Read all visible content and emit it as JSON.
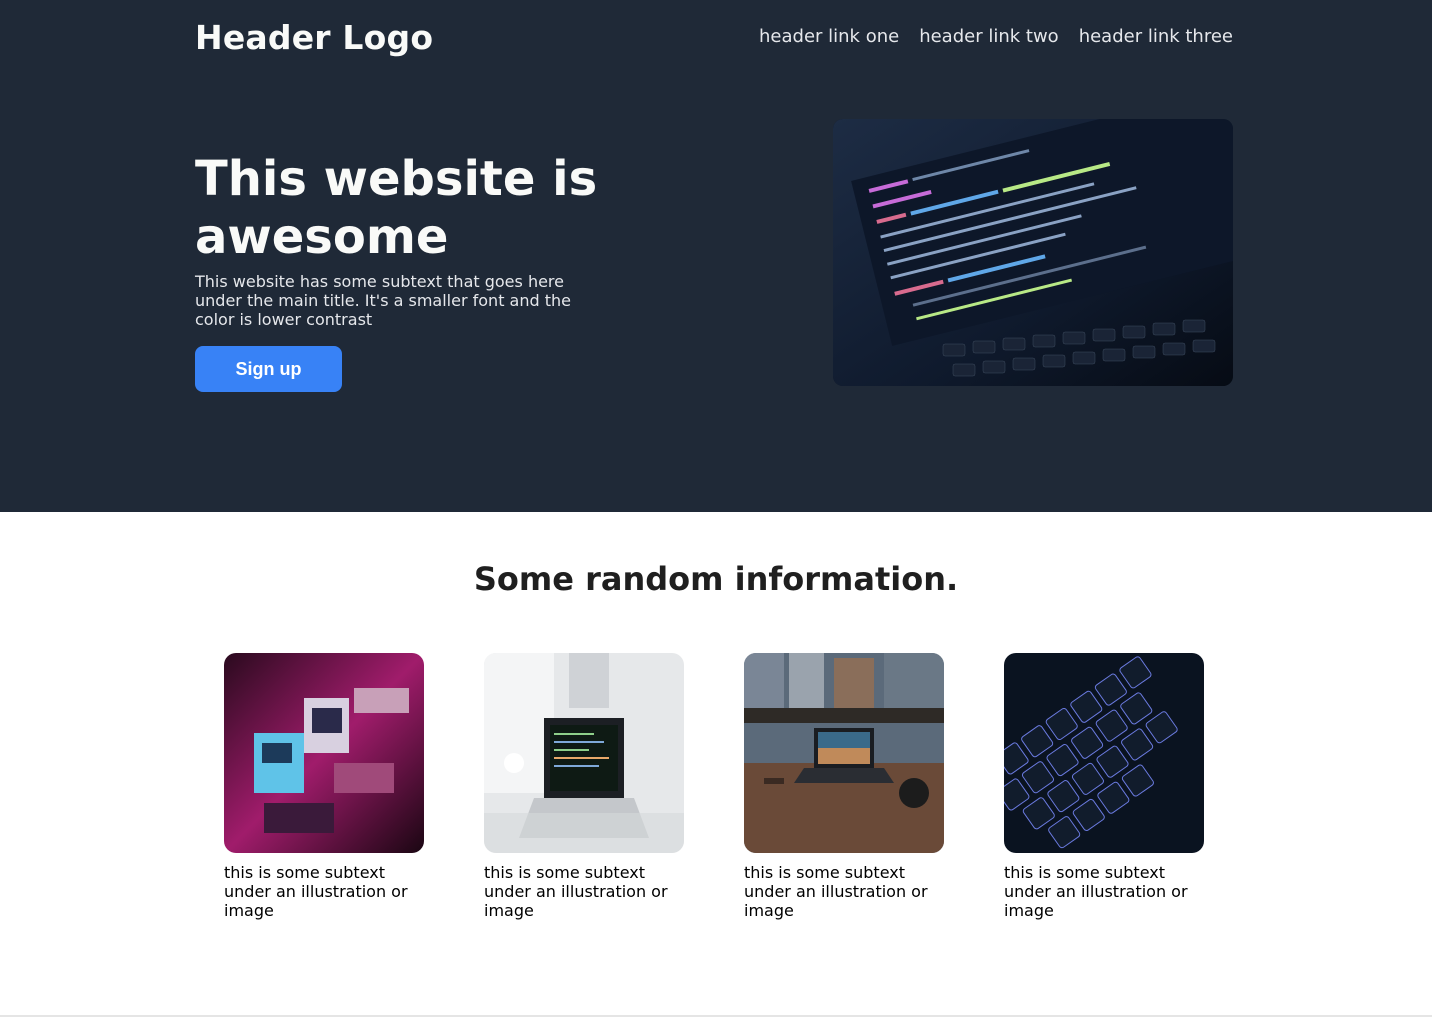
{
  "header": {
    "logo": "Header Logo",
    "links": [
      "header link one",
      "header link two",
      "header link three"
    ]
  },
  "hero": {
    "title": "This website is awesome",
    "subtext": "This website has some subtext that goes here under the main title. It's a smaller font and the color is lower contrast",
    "cta_label": "Sign up"
  },
  "info": {
    "title": "Some random information.",
    "cards": [
      {
        "caption": "this is some subtext under an illustration or image"
      },
      {
        "caption": "this is some subtext under an illustration or image"
      },
      {
        "caption": "this is some subtext under an illustration or image"
      },
      {
        "caption": "this is some subtext under an illustration or image"
      }
    ]
  },
  "colors": {
    "hero_bg": "#1f2937",
    "accent": "#3882f6",
    "hero_text": "#f9faf8"
  },
  "images": [
    "code-on-laptop-image",
    "retro-computers-image",
    "laptop-desk-image",
    "laptop-city-window-image",
    "keyboard-closeup-image"
  ]
}
